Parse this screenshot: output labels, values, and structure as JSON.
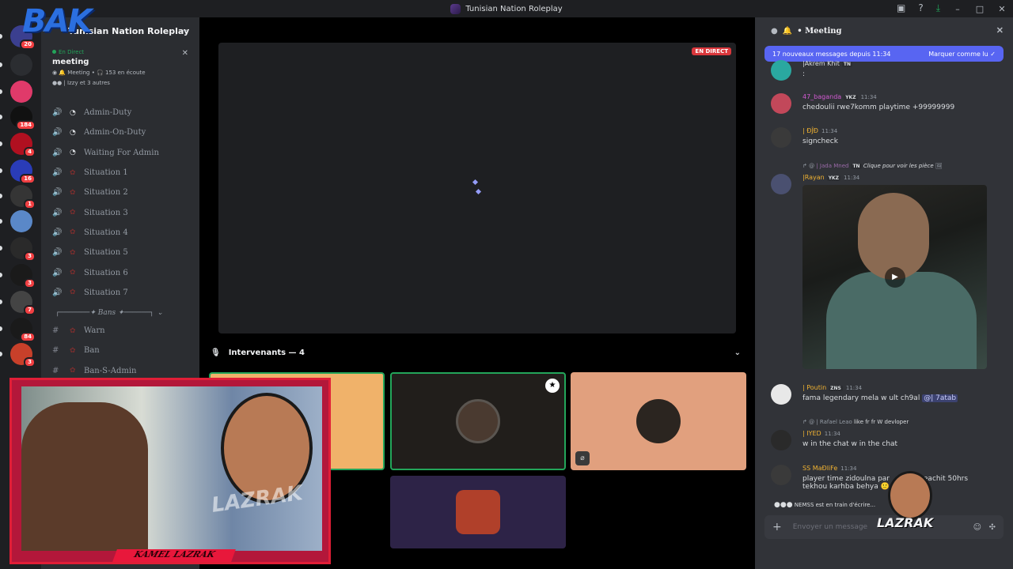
{
  "window": {
    "title": "Tunisian Nation Roleplay"
  },
  "servers": [
    {
      "badge": "20",
      "color": "#3b3f8f"
    },
    {
      "badge": "",
      "color": "#2b2d31"
    },
    {
      "badge": "",
      "color": "#e03a6a"
    },
    {
      "badge": "184",
      "color": "#111111"
    },
    {
      "badge": "4",
      "color": "#b01020"
    },
    {
      "badge": "16",
      "color": "#2a3cb8"
    },
    {
      "badge": "1",
      "color": "#353535"
    },
    {
      "badge": "",
      "color": "#5a88c8"
    },
    {
      "badge": "3",
      "color": "#2a2a2a"
    },
    {
      "badge": "3",
      "color": "#1a1a1a"
    },
    {
      "badge": "7",
      "color": "#444444"
    },
    {
      "badge": "84",
      "color": "#1a1a1a"
    },
    {
      "badge": "3",
      "color": "#c8402a"
    }
  ],
  "sidebar": {
    "server_name": "Tunisian Nation Roleplay",
    "live": {
      "tag": "En Direct",
      "title": "meeting",
      "meta": "Meeting • 🎧 153 en écoute",
      "users": "| Izzy et 3 autres"
    },
    "channels": [
      {
        "name": "Admin-Duty",
        "icon": "speaker-icon",
        "sub": "clock"
      },
      {
        "name": "Admin-On-Duty",
        "icon": "speaker-icon",
        "sub": "clock"
      },
      {
        "name": "Waiting For Admin",
        "icon": "speaker-icon",
        "sub": "clock"
      },
      {
        "name": "Situation 1",
        "icon": "speaker-icon",
        "sub": "flower"
      },
      {
        "name": "Situation 2",
        "icon": "speaker-icon",
        "sub": "flower"
      },
      {
        "name": "Situation 3",
        "icon": "speaker-icon",
        "sub": "flower"
      },
      {
        "name": "Situation 4",
        "icon": "speaker-icon",
        "sub": "flower"
      },
      {
        "name": "Situation 5",
        "icon": "speaker-icon",
        "sub": "flower"
      },
      {
        "name": "Situation 6",
        "icon": "speaker-icon",
        "sub": "flower"
      },
      {
        "name": "Situation 7",
        "icon": "speaker-icon",
        "sub": "flower"
      }
    ],
    "category": "┌───────✦ Bans ✦──────┐",
    "text_channels": [
      {
        "name": "Warn"
      },
      {
        "name": "Ban"
      },
      {
        "name": "Ban-S-Admin"
      }
    ]
  },
  "stage": {
    "live_badge": "EN DIRECT",
    "speakers_label": "Intervenants — 4"
  },
  "tiles": [
    {
      "color": "#f0b26a",
      "avatar": ""
    },
    {
      "color": "#211e1b",
      "avatar": "#4a3a30"
    },
    {
      "color": "#e1a07e",
      "avatar": "#2b2520"
    },
    {
      "color": "#2d2347",
      "avatar": "#b0402a"
    }
  ],
  "webcam": {
    "name": "KAMEL LAZRAK",
    "watermark": "LAZRAK"
  },
  "overlay": {
    "tl_logo": "BAK",
    "br_logo": "LAZRAK"
  },
  "chat": {
    "title": "Meeting",
    "new_messages": "17 nouveaux messages depuis 11:34",
    "mark_read": "Marquer comme lu",
    "messages": [
      {
        "author": "|Akrem Khit",
        "tag": "TN",
        "time": "",
        "text": ":",
        "color": "#dbdee1",
        "av": "#2aa8a0"
      },
      {
        "author": "47_baganda",
        "tag": "YKZ",
        "time": "11:34",
        "text": "chedoulii rwe7komm playtime +99999999",
        "color": "#d25ad2",
        "av": "#c2485a"
      },
      {
        "author": "| ĐĴĐ",
        "tag": "",
        "time": "11:34",
        "text": "signcheck",
        "color": "#f0b232",
        "av": "#3a3a3a"
      },
      {
        "author": "|Rayan",
        "tag": "YKZ",
        "time": "11:34",
        "text": "",
        "color": "#f0b232",
        "av": "#4a5070"
      },
      {
        "author": "| Poutin",
        "tag": "ZNS",
        "time": "11:34",
        "text": "fama legendary mela w ult ch9al",
        "color": "#f0b232",
        "av": "#e8e8e8"
      },
      {
        "author": "| IYED",
        "tag": "",
        "time": "11:34",
        "text": "w in the chat w in the chat",
        "color": "#f0b232",
        "av": "#2a2a2a"
      },
      {
        "author": "SS MaÐliFe",
        "tag": "",
        "time": "11:34",
        "text": "player time zidoulna par",
        "color": "#f0b232",
        "av": "#3a3a3a"
      }
    ],
    "reply1": {
      "author": "| Jada Mned",
      "tag": "TN",
      "text": "Clique pour voir les pièce"
    },
    "reply2": {
      "author": "| Rafael Leao",
      "text": "like fr fr W devloper"
    },
    "mention": "| 7atab",
    "mention2": "@",
    "msg7_tail": "eachit 50hrs",
    "msg7_line2": "tekhou karhba behya",
    "typing": "NEMSS est en train d'écrire...",
    "input_placeholder": "Envoyer un message"
  }
}
